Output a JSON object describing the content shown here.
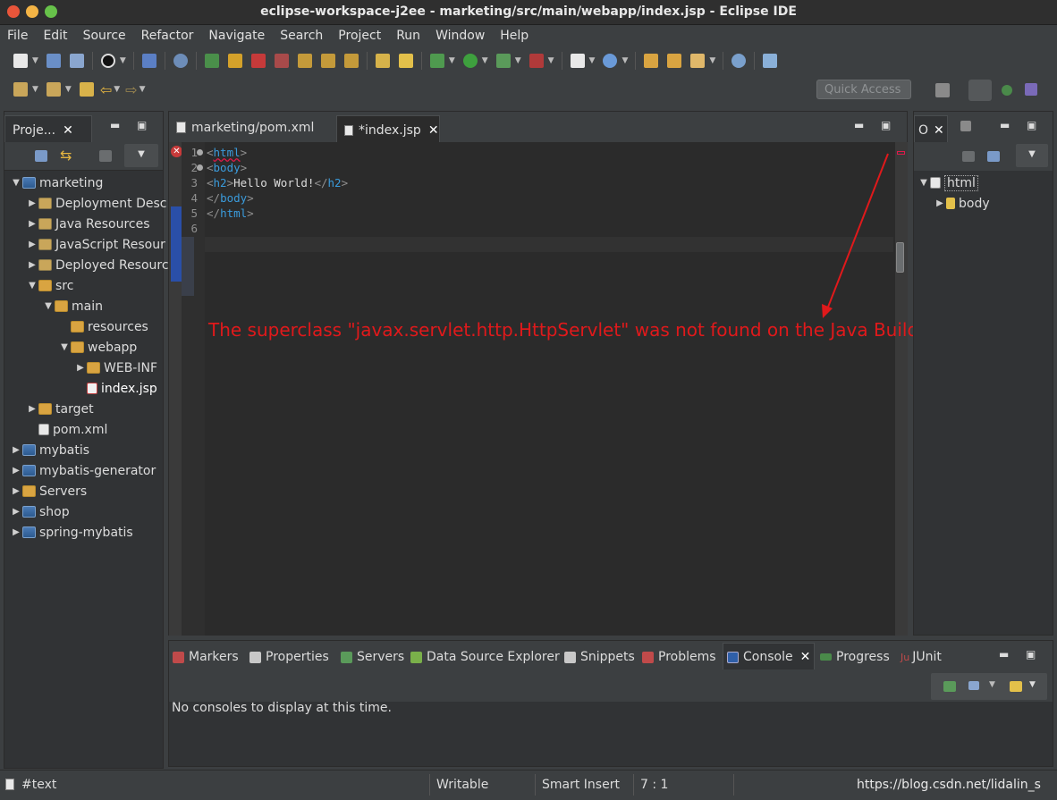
{
  "window": {
    "title": "eclipse-workspace-j2ee - marketing/src/main/webapp/index.jsp - Eclipse IDE"
  },
  "menu": [
    "File",
    "Edit",
    "Source",
    "Refactor",
    "Navigate",
    "Search",
    "Project",
    "Run",
    "Window",
    "Help"
  ],
  "quick_access": {
    "placeholder": "Quick Access"
  },
  "project_explorer": {
    "tab_label": "Proje...",
    "tree": [
      {
        "label": "marketing",
        "depth": 0,
        "expanded": true,
        "icon": "project-icon"
      },
      {
        "label": "Deployment Desc",
        "depth": 1,
        "expanded": false,
        "icon": "deployment-icon"
      },
      {
        "label": "Java Resources",
        "depth": 1,
        "expanded": false,
        "icon": "java-resources-icon"
      },
      {
        "label": "JavaScript Resour",
        "depth": 1,
        "expanded": false,
        "icon": "js-resources-icon"
      },
      {
        "label": "Deployed Resourc",
        "depth": 1,
        "expanded": false,
        "icon": "deployed-icon"
      },
      {
        "label": "src",
        "depth": 1,
        "expanded": true,
        "icon": "folder-icon"
      },
      {
        "label": "main",
        "depth": 2,
        "expanded": true,
        "icon": "folder-icon"
      },
      {
        "label": "resources",
        "depth": 3,
        "expanded": null,
        "icon": "folder-icon"
      },
      {
        "label": "webapp",
        "depth": 3,
        "expanded": true,
        "icon": "folder-icon"
      },
      {
        "label": "WEB-INF",
        "depth": 4,
        "expanded": false,
        "icon": "folder-icon"
      },
      {
        "label": "index.jsp",
        "depth": 4,
        "expanded": null,
        "icon": "jsp-file-icon",
        "selected": true
      },
      {
        "label": "target",
        "depth": 1,
        "expanded": false,
        "icon": "folder-icon"
      },
      {
        "label": "pom.xml",
        "depth": 1,
        "expanded": null,
        "icon": "xml-file-icon"
      },
      {
        "label": "mybatis",
        "depth": 0,
        "expanded": false,
        "icon": "project-icon"
      },
      {
        "label": "mybatis-generator",
        "depth": 0,
        "expanded": false,
        "icon": "project-icon"
      },
      {
        "label": "Servers",
        "depth": 0,
        "expanded": false,
        "icon": "servers-folder-icon"
      },
      {
        "label": "shop",
        "depth": 0,
        "expanded": false,
        "icon": "project-icon"
      },
      {
        "label": "spring-mybatis",
        "depth": 0,
        "expanded": false,
        "icon": "project-icon"
      }
    ]
  },
  "editor": {
    "tabs": [
      {
        "label": "marketing/pom.xml",
        "active": false
      },
      {
        "label": "*index.jsp",
        "active": true
      }
    ],
    "line_numbers": [
      "1",
      "2",
      "3",
      "4",
      "5",
      "6"
    ],
    "lines": [
      {
        "open": "<",
        "tag": "html",
        "close": ">",
        "text": "",
        "etag": ""
      },
      {
        "open": "<",
        "tag": "body",
        "close": ">",
        "text": "",
        "etag": ""
      },
      {
        "open": "<",
        "tag": "h2",
        "close": ">",
        "text": "Hello World!",
        "etag": "h2"
      },
      {
        "open": "</",
        "tag": "body",
        "close": ">",
        "text": "",
        "etag": ""
      },
      {
        "open": "</",
        "tag": "html",
        "close": ">",
        "text": "",
        "etag": ""
      }
    ]
  },
  "annotation": {
    "text": "The superclass \"javax.servlet.http.HttpServlet\" was not found on the Java Build Path",
    "color": "#e0191b"
  },
  "outline": {
    "tab_label": "O",
    "tree": [
      {
        "label": "html",
        "expanded": true
      },
      {
        "label": "body",
        "expanded": false
      }
    ]
  },
  "bottom_panel": {
    "tabs": [
      "Markers",
      "Properties",
      "Servers",
      "Data Source Explorer",
      "Snippets",
      "Problems",
      "Console",
      "Progress",
      "JUnit"
    ],
    "active_tab": "Console",
    "message": "No consoles to display at this time."
  },
  "status_bar": {
    "element": "#text",
    "mode": "Writable",
    "insert": "Smart Insert",
    "position": "7 : 1",
    "watermark": "https://blog.csdn.net/lidalin_s"
  },
  "colors": {
    "selection": "#0a4fd1",
    "highlight_box": "#e0191b",
    "tag_color": "#3a9bdc"
  }
}
